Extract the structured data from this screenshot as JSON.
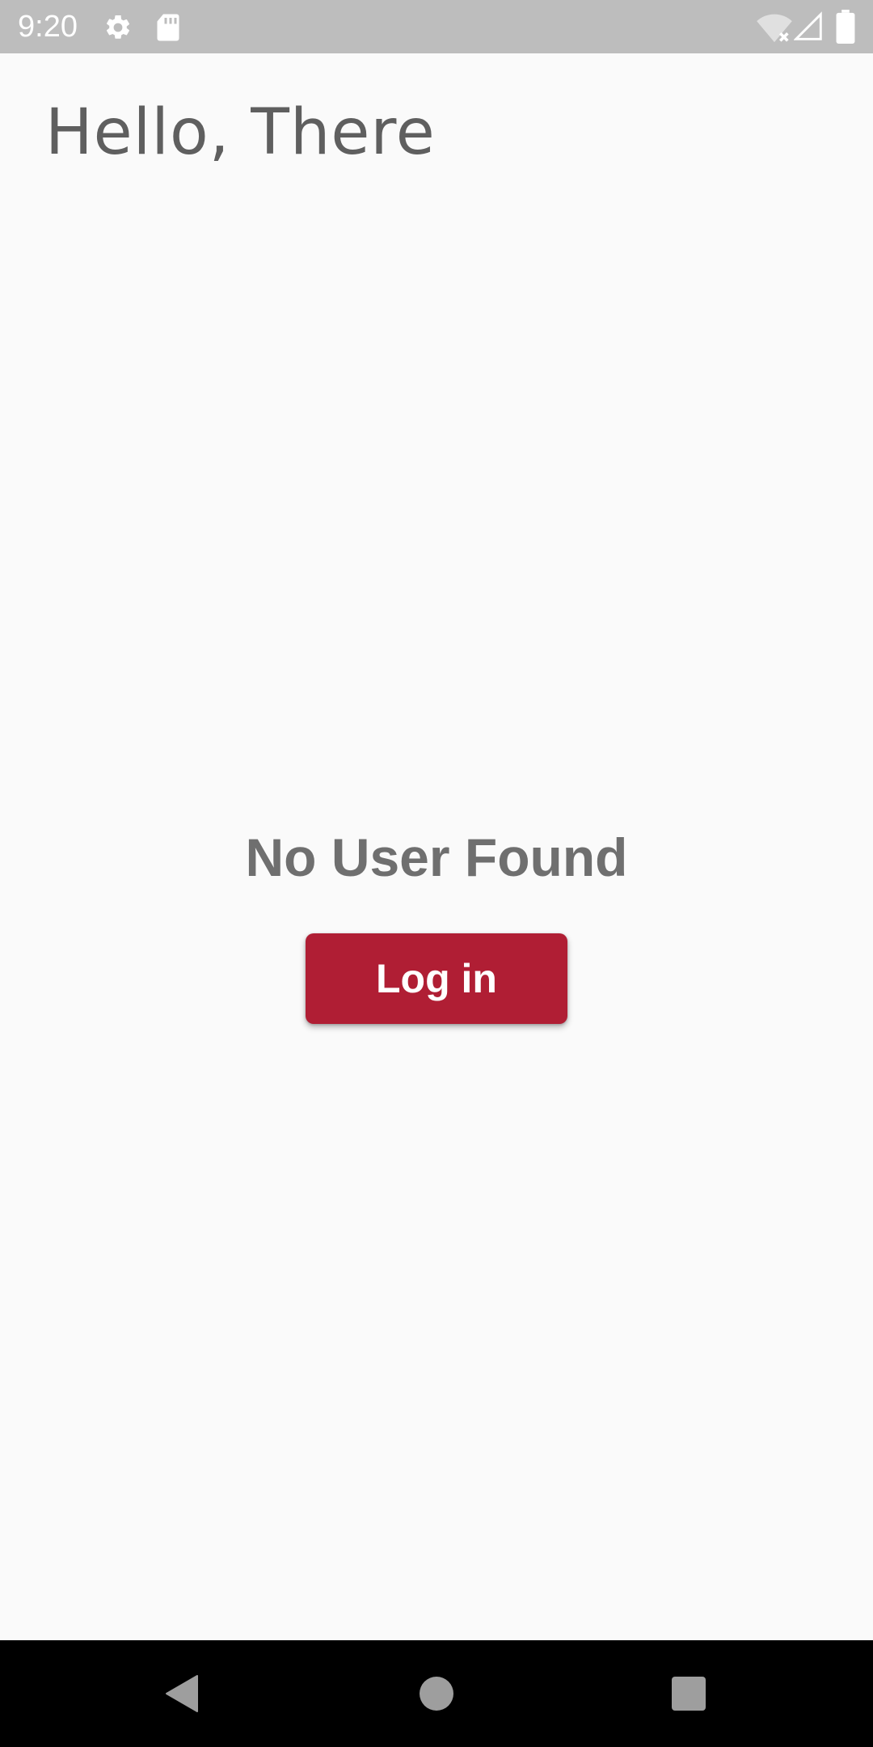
{
  "status_bar": {
    "time": "9:20",
    "icons": [
      "settings-gear-icon",
      "sd-card-icon",
      "wifi-off-icon",
      "cell-signal-icon",
      "battery-icon"
    ],
    "background_color": "#bdbdbd"
  },
  "header": {
    "greeting": "Hello, There"
  },
  "empty_state": {
    "message": "No User Found"
  },
  "actions": {
    "login_label": "Log in",
    "login_color": "#b01e34"
  },
  "nav_bar": {
    "buttons": [
      "back-icon",
      "home-icon",
      "recents-icon"
    ],
    "background_color": "#000000"
  }
}
